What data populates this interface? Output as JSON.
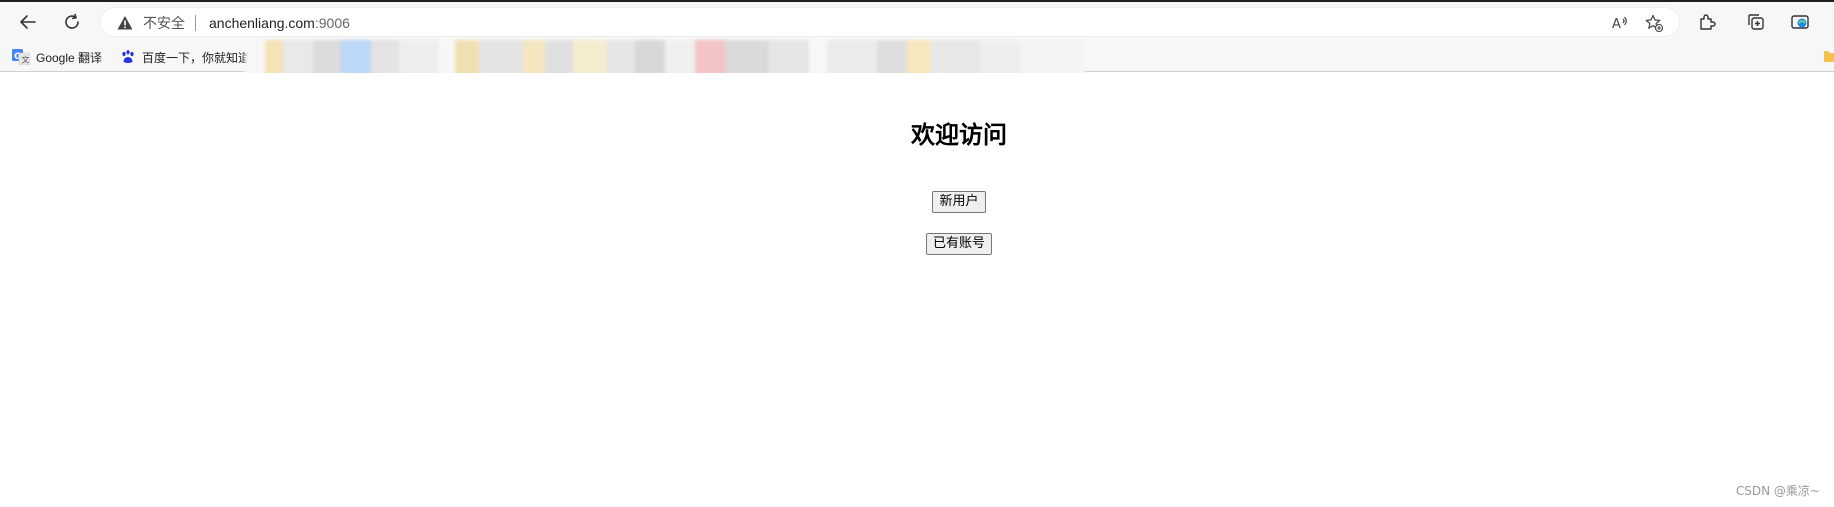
{
  "browser": {
    "security_label": "不安全",
    "url_host": "anchenliang.com",
    "url_port": ":9006"
  },
  "bookmarks": [
    {
      "label": "Google 翻译",
      "icon": "google-translate-icon"
    },
    {
      "label": "百度一下，你就知道",
      "icon": "baidu-paw-icon"
    }
  ],
  "page": {
    "title": "欢迎访问",
    "new_user_button": "新用户",
    "existing_account_button": "已有账号"
  },
  "watermark": "CSDN @乘凉~",
  "colors": {
    "toolbar_bg": "#f7f7f7",
    "page_bg": "#ffffff",
    "button_bg": "#efefef",
    "button_border": "#767676"
  }
}
